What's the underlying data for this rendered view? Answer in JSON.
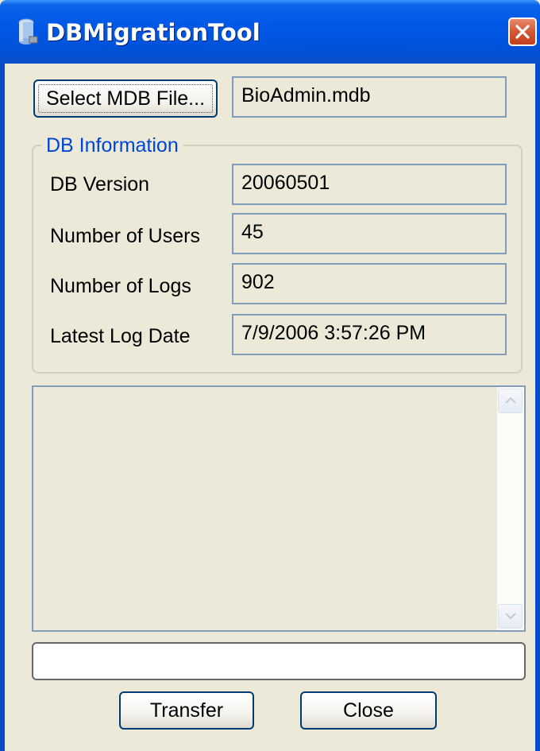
{
  "window": {
    "title": "DBMigrationTool",
    "icon": "database-icon",
    "close_icon": "close-icon",
    "accent": "#0058e6"
  },
  "file": {
    "select_button_label": "Select MDB File...",
    "selected_file": "BioAdmin.mdb"
  },
  "db_info": {
    "group_label": "DB Information",
    "rows": [
      {
        "label": "DB Version",
        "value": "20060501"
      },
      {
        "label": "Number of Users",
        "value": "45"
      },
      {
        "label": "Number of Logs",
        "value": "902"
      },
      {
        "label": "Latest Log Date",
        "value": "7/9/2006 3:57:26 PM"
      }
    ]
  },
  "log": {
    "text": ""
  },
  "progress": {
    "value": 0
  },
  "actions": {
    "transfer_label": "Transfer",
    "close_label": "Close"
  }
}
